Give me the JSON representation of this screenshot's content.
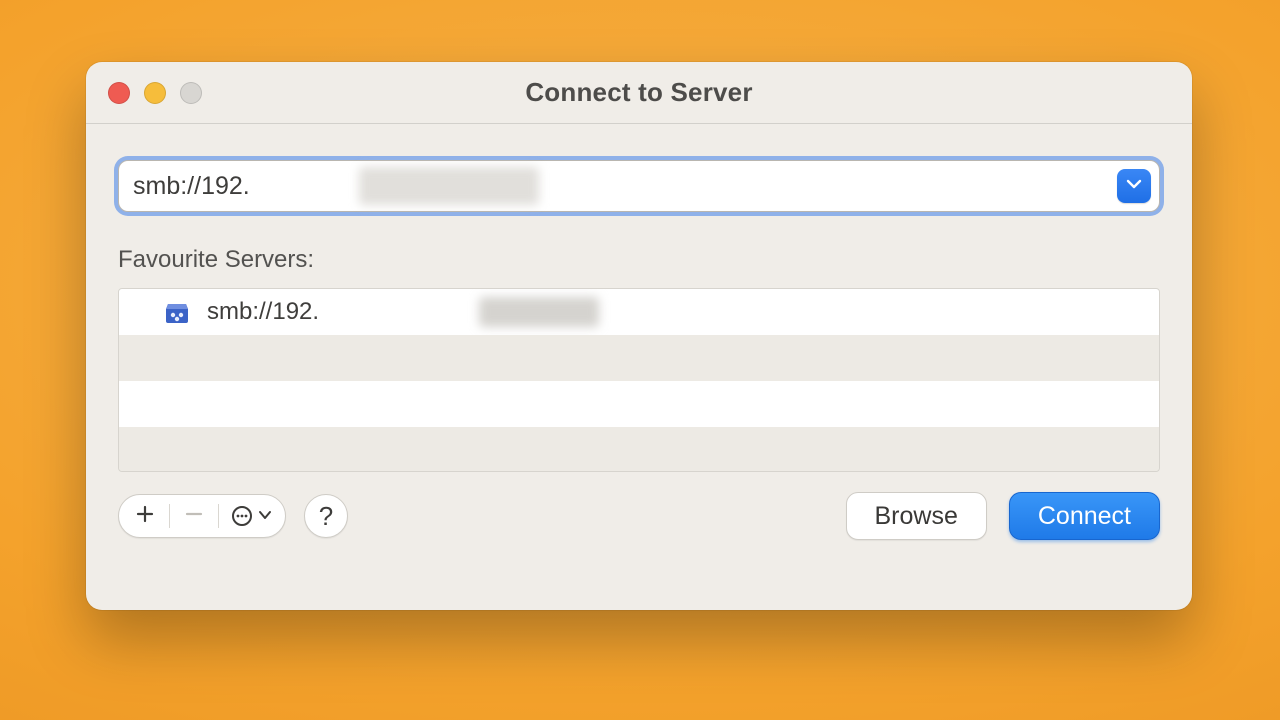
{
  "window": {
    "title": "Connect to Server"
  },
  "address": {
    "value": "smb://192."
  },
  "favourites": {
    "label": "Favourite Servers:",
    "items": [
      {
        "icon": "network-share-icon",
        "text": "smb://192."
      }
    ]
  },
  "footer": {
    "help_label": "?",
    "browse_label": "Browse",
    "connect_label": "Connect"
  }
}
